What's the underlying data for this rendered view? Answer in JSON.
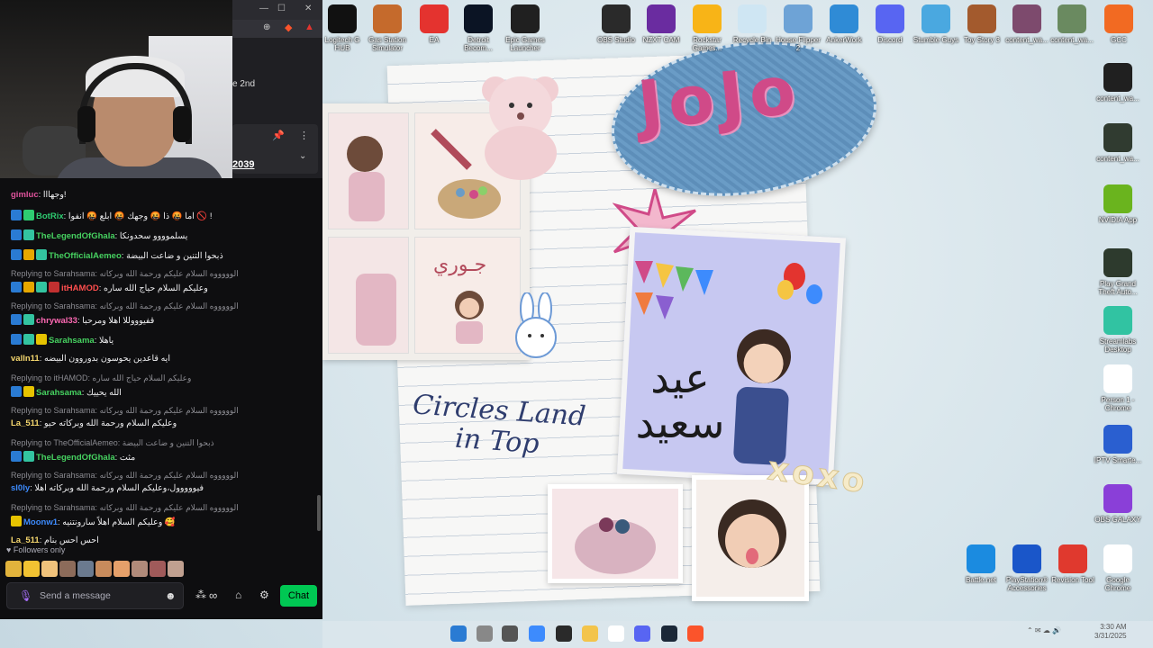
{
  "desktop_top_icons": [
    {
      "label": "Logitech G HUB",
      "icon": "logitech-icon",
      "color": "#111111"
    },
    {
      "label": "Gas Station Simulator",
      "icon": "gas-station-icon",
      "color": "#c56a2c"
    },
    {
      "label": "EA",
      "icon": "ea-icon",
      "color": "#e4332f"
    },
    {
      "label": "Detroit Becom...",
      "icon": "detroit-icon",
      "color": "#0b1424"
    },
    {
      "label": "Epic Games Launcher",
      "icon": "epic-icon",
      "color": "#202020"
    },
    {
      "label": "OBS Studio",
      "icon": "obs-icon",
      "color": "#2a2a2a"
    },
    {
      "label": "NZXT CAM",
      "icon": "nzxt-icon",
      "color": "#6a2ca0"
    },
    {
      "label": "Rockstar Games...",
      "icon": "rockstar-icon",
      "color": "#f8b417"
    },
    {
      "label": "Recycle Bin",
      "icon": "recycle-bin-icon",
      "color": "#cfe6f3"
    },
    {
      "label": "House Flipper 2",
      "icon": "house-icon",
      "color": "#6ea3d6"
    },
    {
      "label": "AnkerWork",
      "icon": "ankerwork-icon",
      "color": "#2f8bd6"
    },
    {
      "label": "Discord",
      "icon": "discord-icon",
      "color": "#5865f2"
    },
    {
      "label": "Stumble Guys",
      "icon": "stumble-icon",
      "color": "#4aa8e0"
    },
    {
      "label": "Toy Story 3",
      "icon": "toystory-icon",
      "color": "#a35a2d"
    },
    {
      "label": "content_wa...",
      "icon": "file-icon",
      "color": "#7d4a6d"
    },
    {
      "label": "content_wa...",
      "icon": "file-icon",
      "color": "#6a8a60"
    },
    {
      "label": "GCC",
      "icon": "gcc-icon",
      "color": "#f26a22"
    }
  ],
  "desktop_right_icons": [
    {
      "label": "content_wa...",
      "icon": "file-icon",
      "color": "#202020"
    },
    {
      "label": "content_wa...",
      "icon": "file-icon",
      "color": "#303b30"
    },
    {
      "label": "NVIDIA App",
      "icon": "nvidia-icon",
      "color": "#6ab41e"
    },
    {
      "label": "Play Grand Theft Auto...",
      "icon": "gta-icon",
      "color": "#2d3a2d"
    },
    {
      "label": "Streamlabs Desktop",
      "icon": "streamlabs-icon",
      "color": "#31c3a2"
    },
    {
      "label": "Person 1 - Chrome",
      "icon": "chrome-icon",
      "color": "#ffffff"
    },
    {
      "label": "IPTV Smarte...",
      "icon": "iptv-icon",
      "color": "#2a5fd0"
    },
    {
      "label": "OBS GALAXY",
      "icon": "galaxy-icon",
      "color": "#8a3fd8"
    }
  ],
  "desktop_bottom_icons": [
    {
      "label": "Battle.net",
      "icon": "battlenet-icon",
      "color": "#1b8be0"
    },
    {
      "label": "PlayStation® Accessories",
      "icon": "playstation-icon",
      "color": "#1a56c9"
    },
    {
      "label": "Revision Tool",
      "icon": "revision-icon",
      "color": "#e0392e"
    },
    {
      "label": "Google Chrome",
      "icon": "chrome-icon",
      "color": "#ffffff"
    }
  ],
  "wallpaper": {
    "title": "JoJo",
    "arabic_greeting": "عيد سعيد",
    "photo_label": "جـوري",
    "slogan": "Circles Land in Top",
    "xoxo": "xoxo",
    "colors": {
      "patch": "#6a9cc6",
      "pink": "#d04a88",
      "card": "#c7c8f1"
    }
  },
  "browser": {
    "stream_text": "e 2nd",
    "pinned_number": "2039"
  },
  "chat": {
    "messages": [
      {
        "user": "gimluc",
        "text": "وجهااا!",
        "color": "#e0539c",
        "badges": []
      },
      {
        "user": "BotRix",
        "text": "اما 🤬 ذا 🤬 وجهك 🤬 ابلع 🤬 انفوا 🚫 !",
        "color": "#2ecc71",
        "badges": [
          "#2a7bd3",
          "#2ecc71"
        ]
      },
      {
        "user": "TheLegendOfGhala",
        "text": "يسلموووو سحدونكا",
        "color": "#46d160",
        "badges": [
          "#2a7bd3",
          "#33c4a0"
        ]
      },
      {
        "user": "TheOfficialAemeo",
        "text": "ذبحوا التنين و ضاعت البيضة",
        "color": "#46d160",
        "badges": [
          "#2a7bd3",
          "#e6a700",
          "#33c4a0"
        ]
      },
      {
        "reply": "Replying to Sarahsama: الوووووه السلام عليكم ورحمة الله وبركاته",
        "user": "itHAMOD",
        "text": "وعليكم السلام حياج الله ساره",
        "color": "#ff4e4e",
        "badges": [
          "#2a7bd3",
          "#e6a700",
          "#33c4a0",
          "#c23030"
        ]
      },
      {
        "reply": "Replying to Sarahsama: الوووووه السلام عليكم ورحمة الله وبركاته",
        "user": "chrywal33",
        "text": "قفيوووللا اهلا ومرحبا",
        "color": "#ff69b4",
        "badges": [
          "#2a7bd3",
          "#33c4a0"
        ]
      },
      {
        "user": "Sarahsama",
        "text": "ياهلا",
        "color": "#46d160",
        "badges": [
          "#2a7bd3",
          "#33c4a0",
          "#e6c300"
        ]
      },
      {
        "user": "valln11",
        "text": "ايه قاعدين يحوسون بدوروون البيضه",
        "color": "#f5d76e",
        "badges": []
      },
      {
        "reply": "Replying to itHAMOD: وعليكم السلام حياج الله ساره",
        "user": "Sarahsama",
        "text": "الله يحييك",
        "color": "#46d160",
        "badges": [
          "#2a7bd3",
          "#e6c300"
        ]
      },
      {
        "reply": "Replying to Sarahsama: الوووووه السلام عليكم ورحمة الله وبركاته",
        "user": "La_511",
        "text": "وعليكم السلام ورحمة الله وبركاته حيو",
        "color": "#f5d76e",
        "badges": []
      },
      {
        "reply": "Replying to TheOfficialAemeo: ذبحوا التنين و ضاعت البيضة",
        "user": "TheLegendOfGhala",
        "text": "مثت",
        "color": "#46d160",
        "badges": [
          "#2a7bd3",
          "#33c4a0"
        ]
      },
      {
        "reply": "Replying to Sarahsama: الوووووه السلام عليكم ورحمة الله وبركاته",
        "user": "sl0ly",
        "text": "فيووووول،وعليكم السلام ورحمة الله وبركاته اهلا",
        "color": "#3d8bfd",
        "badges": []
      },
      {
        "reply": "Replying to Sarahsama: الوووووه السلام عليكم ورحمة الله وبركاته",
        "user": "Moonw1",
        "text": "وعليكم السلام اهلاً سارونتنيه 🥰",
        "color": "#3d8bfd",
        "badges": [
          "#e6c300"
        ]
      },
      {
        "user": "La_511",
        "text": "احس احس بنام",
        "color": "#f5d76e",
        "badges": []
      }
    ],
    "emote_row_colors": [
      "#e2b33c",
      "#f1c232",
      "#f0c27b",
      "#8c6b5a",
      "#6b7a8f",
      "#c88b5c",
      "#e6a06a",
      "#b08a7a",
      "#a05a5a",
      "#c0a090"
    ],
    "followers_label": "Followers only",
    "input_placeholder": "Send a message",
    "points": "∞",
    "chat_button": "Chat"
  },
  "taskbar": {
    "icons": [
      {
        "icon": "windows-start-icon",
        "color": "#2a7bd3"
      },
      {
        "icon": "search-icon",
        "color": "#888888"
      },
      {
        "icon": "task-view-icon",
        "color": "#555555"
      },
      {
        "icon": "widgets-icon",
        "color": "#3d8bfd"
      },
      {
        "icon": "obs-icon",
        "color": "#2a2a2a"
      },
      {
        "icon": "file-explorer-icon",
        "color": "#f3c44b"
      },
      {
        "icon": "chrome-icon",
        "color": "#ffffff"
      },
      {
        "icon": "discord-icon",
        "color": "#5865f2"
      },
      {
        "icon": "steam-icon",
        "color": "#1b2838"
      },
      {
        "icon": "brave-icon",
        "color": "#fb542b"
      }
    ],
    "clock_time": "3:30 AM",
    "clock_date": "3/31/2025"
  }
}
